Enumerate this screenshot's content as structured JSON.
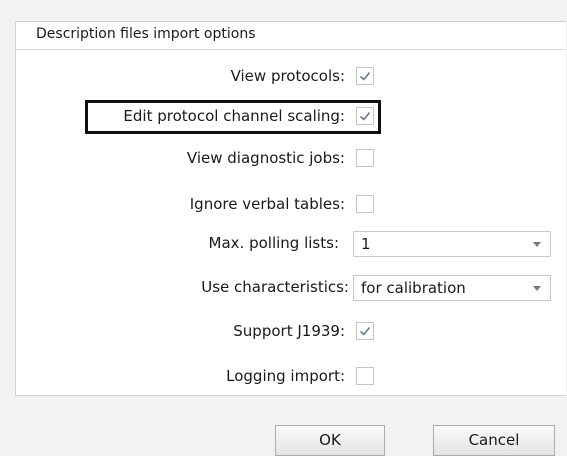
{
  "group": {
    "title": "Description files import options"
  },
  "options": [
    {
      "label": "View protocols:",
      "checked": true
    },
    {
      "label": "Edit protocol channel scaling:",
      "checked": true
    },
    {
      "label": "View diagnostic jobs:",
      "checked": false
    },
    {
      "label": "Ignore verbal tables:",
      "checked": false
    }
  ],
  "max_polling": {
    "label": "Max. polling lists:",
    "value": "1"
  },
  "use_characteristics": {
    "label": "Use characteristics:",
    "value": "for calibration"
  },
  "options2": [
    {
      "label": "Support J1939:",
      "checked": true
    },
    {
      "label": "Logging import:",
      "checked": false
    }
  ],
  "buttons": {
    "ok": "OK",
    "cancel": "Cancel"
  },
  "colors": {
    "checkmark": "#6a7b8c",
    "highlight_border": "#111111",
    "background": "#f2f2f2"
  }
}
